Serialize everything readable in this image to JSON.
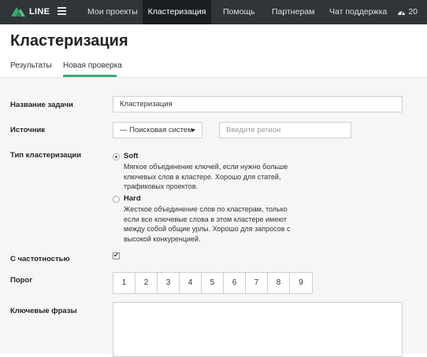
{
  "topbar": {
    "brand": "LINE",
    "brand_icon": "line-logo-icon",
    "menu_icon": "hamburger-icon",
    "nav": [
      {
        "label": "Мои проекты",
        "active": false
      },
      {
        "label": "Кластеризация",
        "active": true
      },
      {
        "label": "Помощь",
        "active": false
      },
      {
        "label": "Партнерам",
        "active": false
      },
      {
        "label": "Чат поддержка",
        "active": false
      }
    ],
    "counter_icon": "gauge-icon",
    "counter_value": "20"
  },
  "page": {
    "title": "Кластеризация",
    "tabs": [
      {
        "label": "Результаты",
        "active": false
      },
      {
        "label": "Новая проверка",
        "active": true
      }
    ]
  },
  "form": {
    "task_name": {
      "label": "Название задачи",
      "value": "Кластеризация"
    },
    "source": {
      "label": "Источник",
      "selected": "— Поисковая систем",
      "region_placeholder": "Введите регион"
    },
    "cluster_type": {
      "label": "Тип кластеризации",
      "options": [
        {
          "title": "Soft",
          "description": "Мягкое объединение ключей, если нужно больше ключевых слов в кластере. Хорошо для статей, трафиковых проектов.",
          "checked": true
        },
        {
          "title": "Hard",
          "description": "Жесткое объединение слов по кластерам, только если все ключевые слова в этом кластере имеют между собой общие урлы. Хорошо для запросов с высокой конкуренцией.",
          "checked": false
        }
      ]
    },
    "frequency": {
      "label": "С частотностью",
      "checked": true,
      "check_glyph": "✔"
    },
    "threshold": {
      "label": "Порог",
      "values": [
        "1",
        "2",
        "3",
        "4",
        "5",
        "6",
        "7",
        "8",
        "9"
      ]
    },
    "keywords": {
      "label": "Ключевые фразы",
      "value": ""
    }
  },
  "colors": {
    "topbar": "#2f3539",
    "active_nav": "#1b1f22",
    "accent": "#3fa76f"
  }
}
